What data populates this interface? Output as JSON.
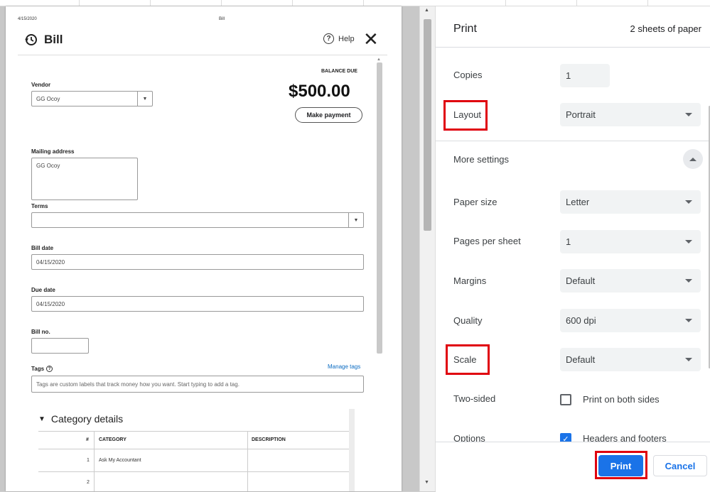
{
  "preview": {
    "page_date": "4/15/2020",
    "page_title": "Bill",
    "bill_heading": "Bill",
    "help_label": "Help",
    "help_symbol": "?",
    "close_symbol": "✕",
    "balance_due_label": "BALANCE DUE",
    "balance_due_amount": "$500.00",
    "make_payment_label": "Make payment",
    "vendor_label": "Vendor",
    "vendor_value": "GG Ocoy",
    "mailing_address_label": "Mailing address",
    "mailing_address_value": "GG Ocoy",
    "terms_label": "Terms",
    "terms_value": "",
    "bill_date_label": "Bill date",
    "bill_date_value": "04/15/2020",
    "due_date_label": "Due date",
    "due_date_value": "04/15/2020",
    "bill_no_label": "Bill no.",
    "bill_no_value": "",
    "tags_label": "Tags",
    "manage_tags_label": "Manage tags",
    "tags_placeholder": "Tags are custom labels that track money how you want. Start typing to add a tag.",
    "category_details_title": "Category details",
    "category_table": {
      "headers": [
        "#",
        "CATEGORY",
        "DESCRIPTION"
      ],
      "rows": [
        {
          "num": "1",
          "category": "Ask My Accountant",
          "description": ""
        },
        {
          "num": "2",
          "category": "",
          "description": ""
        }
      ]
    }
  },
  "print_panel": {
    "title": "Print",
    "sheets": "2 sheets of paper",
    "copies_label": "Copies",
    "copies_value": "1",
    "layout_label": "Layout",
    "layout_value": "Portrait",
    "more_settings_label": "More settings",
    "paper_size_label": "Paper size",
    "paper_size_value": "Letter",
    "pages_per_sheet_label": "Pages per sheet",
    "pages_per_sheet_value": "1",
    "margins_label": "Margins",
    "margins_value": "Default",
    "quality_label": "Quality",
    "quality_value": "600 dpi",
    "scale_label": "Scale",
    "scale_value": "Default",
    "two_sided_label": "Two-sided",
    "two_sided_option": "Print on both sides",
    "two_sided_checked": false,
    "options_label": "Options",
    "headers_footers_option": "Headers and footers",
    "headers_footers_checked": true,
    "print_button": "Print",
    "cancel_button": "Cancel"
  },
  "colors": {
    "accent": "#1a73e8",
    "highlight": "#e0000e",
    "link": "#0a6bc2"
  }
}
